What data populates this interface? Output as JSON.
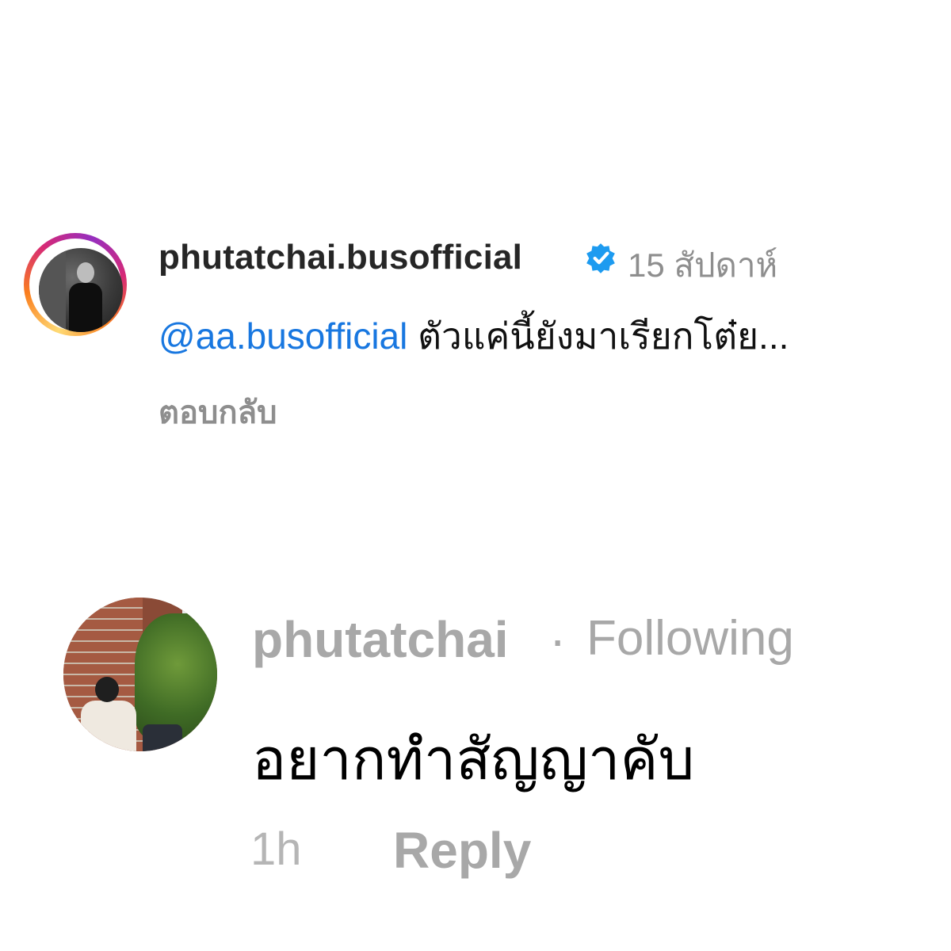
{
  "comment_1": {
    "username": "phutatchai.busofficial",
    "verified": true,
    "timestamp": "15 สัปดาห์",
    "mention": "@aa.busofficial",
    "text": "ตัวแค่นี้ยังมาเรียกโต๋ย...",
    "reply_label": "ตอบกลับ",
    "avatar_ring_colors": [
      "#feda75",
      "#fa7e1e",
      "#d62976",
      "#962fbf"
    ]
  },
  "comment_2": {
    "username": "phutatchai",
    "separator": "·",
    "follow_status": "Following",
    "text": "อยากทำสัญญาคับ",
    "timestamp": "1h",
    "reply_label": "Reply"
  },
  "colors": {
    "mention": "#1877e0",
    "verified_badge": "#1d9bf0",
    "muted_text": "#8e8e8e"
  }
}
